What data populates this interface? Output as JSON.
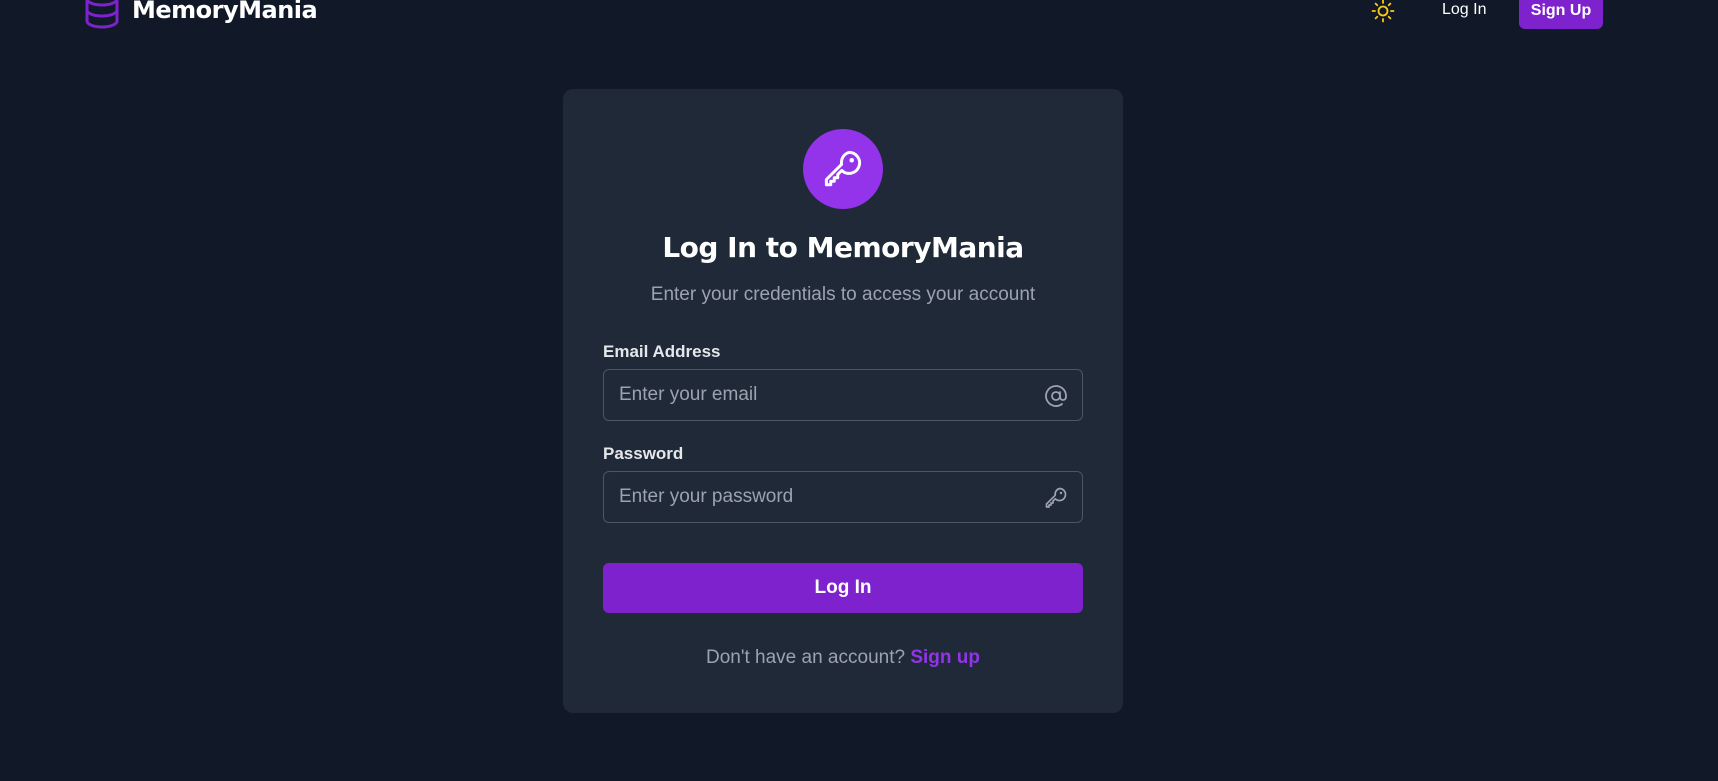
{
  "navbar": {
    "brand_name": "MemoryMania",
    "brand_icon": "database-icon",
    "theme_toggle_icon": "sun-icon",
    "login_label": "Log In",
    "signup_label": "Sign Up"
  },
  "card": {
    "badge_icon": "key-icon",
    "title": "Log In to MemoryMania",
    "subtitle": "Enter your credentials to access your account",
    "email": {
      "label": "Email Address",
      "placeholder": "Enter your email",
      "value": "",
      "icon": "at-sign-icon"
    },
    "password": {
      "label": "Password",
      "placeholder": "Enter your password",
      "value": "",
      "icon": "key-icon"
    },
    "submit_label": "Log In",
    "signup_prompt": "Don't have an account?",
    "signup_link": "Sign up"
  },
  "colors": {
    "page_background": "#111827",
    "card_background": "#1f2937",
    "accent": "#7e22ce",
    "accent_light": "#9333ea",
    "muted_text": "#9ca3af",
    "sun": "#facc15"
  }
}
